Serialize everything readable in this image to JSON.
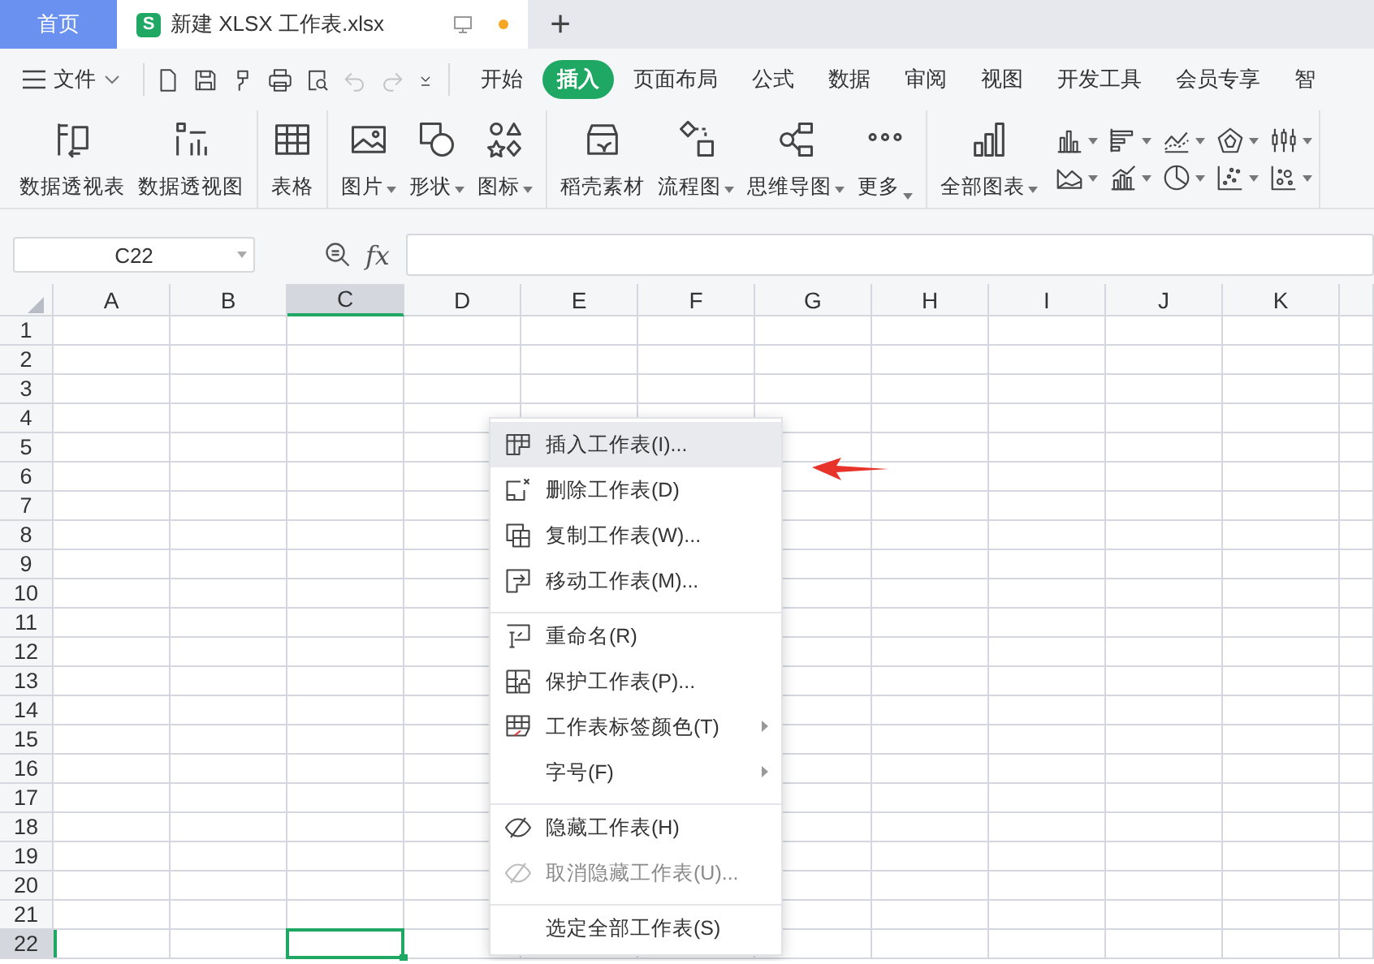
{
  "tabs": [
    {
      "kind": "home",
      "label": "首页",
      "selected": false
    },
    {
      "kind": "doc",
      "logo": "S",
      "label": "新建 XLSX 工作表.xlsx",
      "selected": true,
      "modified": true
    }
  ],
  "new_tab": "+",
  "menu_bar": {
    "file": "文件",
    "quick_tools": [
      {
        "kind": "new",
        "disabled": false
      },
      {
        "kind": "save",
        "disabled": false
      },
      {
        "kind": "brush",
        "disabled": false
      },
      {
        "kind": "print",
        "disabled": false
      },
      {
        "kind": "preview",
        "disabled": false
      },
      {
        "kind": "undo",
        "disabled": true
      },
      {
        "kind": "redo",
        "disabled": true
      },
      {
        "kind": "caret",
        "disabled": false
      }
    ],
    "tabs": [
      {
        "label": "开始",
        "selected": false
      },
      {
        "label": "插入",
        "selected": true
      },
      {
        "label": "页面布局",
        "selected": false
      },
      {
        "label": "公式",
        "selected": false
      },
      {
        "label": "数据",
        "selected": false
      },
      {
        "label": "审阅",
        "selected": false
      },
      {
        "label": "视图",
        "selected": false
      },
      {
        "label": "开发工具",
        "selected": false
      },
      {
        "label": "会员专享",
        "selected": false
      },
      {
        "label": "智",
        "selected": false
      }
    ]
  },
  "ribbon": {
    "groups": [
      {
        "buttons": [
          {
            "kind": "pivot",
            "label": "数据透视表",
            "dropdown": false
          },
          {
            "kind": "pivotchart",
            "label": "数据透视图",
            "dropdown": false
          }
        ]
      },
      {
        "buttons": [
          {
            "kind": "table",
            "label": "表格",
            "dropdown": false
          }
        ]
      },
      {
        "buttons": [
          {
            "kind": "picture",
            "label": "图片",
            "dropdown": true
          },
          {
            "kind": "shape",
            "label": "形状",
            "dropdown": true
          },
          {
            "kind": "icons",
            "label": "图标",
            "dropdown": true
          }
        ]
      },
      {
        "buttons": [
          {
            "kind": "material",
            "label": "稻壳素材",
            "dropdown": false
          },
          {
            "kind": "flowchart",
            "label": "流程图",
            "dropdown": true
          },
          {
            "kind": "mindmap",
            "label": "思维导图",
            "dropdown": true
          },
          {
            "kind": "more",
            "label": "更多",
            "dropdown": true
          }
        ]
      },
      {
        "buttons": [
          {
            "kind": "allcharts",
            "label": "全部图表",
            "dropdown": true
          }
        ],
        "chart_buttons": [
          {
            "kind": "column"
          },
          {
            "kind": "hbar"
          },
          {
            "kind": "line"
          },
          {
            "kind": "radar"
          },
          {
            "kind": "stock"
          },
          {
            "kind": "area"
          },
          {
            "kind": "combo"
          },
          {
            "kind": "pie"
          },
          {
            "kind": "scatter"
          },
          {
            "kind": "bubble"
          }
        ]
      }
    ]
  },
  "formula_bar": {
    "name_box": "C22",
    "fx": "fx"
  },
  "sheet": {
    "columns": [
      {
        "label": "A",
        "selected": false
      },
      {
        "label": "B",
        "selected": false
      },
      {
        "label": "C",
        "selected": true
      },
      {
        "label": "D",
        "selected": false
      },
      {
        "label": "E",
        "selected": false
      },
      {
        "label": "F",
        "selected": false
      },
      {
        "label": "G",
        "selected": false
      },
      {
        "label": "H",
        "selected": false
      },
      {
        "label": "I",
        "selected": false
      },
      {
        "label": "J",
        "selected": false
      },
      {
        "label": "K",
        "selected": false
      }
    ],
    "rows": [
      {
        "label": "1",
        "selected": false
      },
      {
        "label": "2",
        "selected": false
      },
      {
        "label": "3",
        "selected": false
      },
      {
        "label": "4",
        "selected": false
      },
      {
        "label": "5",
        "selected": false
      },
      {
        "label": "6",
        "selected": false
      },
      {
        "label": "7",
        "selected": false
      },
      {
        "label": "8",
        "selected": false
      },
      {
        "label": "9",
        "selected": false
      },
      {
        "label": "10",
        "selected": false
      },
      {
        "label": "11",
        "selected": false
      },
      {
        "label": "12",
        "selected": false
      },
      {
        "label": "13",
        "selected": false
      },
      {
        "label": "14",
        "selected": false
      },
      {
        "label": "15",
        "selected": false
      },
      {
        "label": "16",
        "selected": false
      },
      {
        "label": "17",
        "selected": false
      },
      {
        "label": "18",
        "selected": false
      },
      {
        "label": "19",
        "selected": false
      },
      {
        "label": "20",
        "selected": false
      },
      {
        "label": "21",
        "selected": false
      },
      {
        "label": "22",
        "selected": true
      }
    ]
  },
  "context_menu": {
    "items": [
      {
        "kind": "insert",
        "label": "插入工作表(I)...",
        "selected": true,
        "disabled": false,
        "submenu": false,
        "separator_before": false
      },
      {
        "kind": "delete",
        "label": "删除工作表(D)",
        "selected": false,
        "disabled": false,
        "submenu": false,
        "separator_before": false
      },
      {
        "kind": "copy",
        "label": "复制工作表(W)...",
        "selected": false,
        "disabled": false,
        "submenu": false,
        "separator_before": false
      },
      {
        "kind": "move",
        "label": "移动工作表(M)...",
        "selected": false,
        "disabled": false,
        "submenu": false,
        "separator_before": false
      },
      {
        "kind": "rename",
        "label": "重命名(R)",
        "selected": false,
        "disabled": false,
        "submenu": false,
        "separator_before": true
      },
      {
        "kind": "protect",
        "label": "保护工作表(P)...",
        "selected": false,
        "disabled": false,
        "submenu": false,
        "separator_before": false
      },
      {
        "kind": "tabcolor",
        "label": "工作表标签颜色(T)",
        "selected": false,
        "disabled": false,
        "submenu": true,
        "separator_before": false
      },
      {
        "kind": "plain",
        "label": "字号(F)",
        "selected": false,
        "disabled": false,
        "submenu": true,
        "separator_before": false
      },
      {
        "kind": "hide",
        "label": "隐藏工作表(H)",
        "selected": false,
        "disabled": false,
        "submenu": false,
        "separator_before": true
      },
      {
        "kind": "hide",
        "label": "取消隐藏工作表(U)...",
        "selected": false,
        "disabled": true,
        "submenu": false,
        "separator_before": false
      },
      {
        "kind": "plain",
        "label": "选定全部工作表(S)",
        "selected": false,
        "disabled": false,
        "submenu": false,
        "separator_before": true
      }
    ]
  },
  "pointer_arrow": true
}
